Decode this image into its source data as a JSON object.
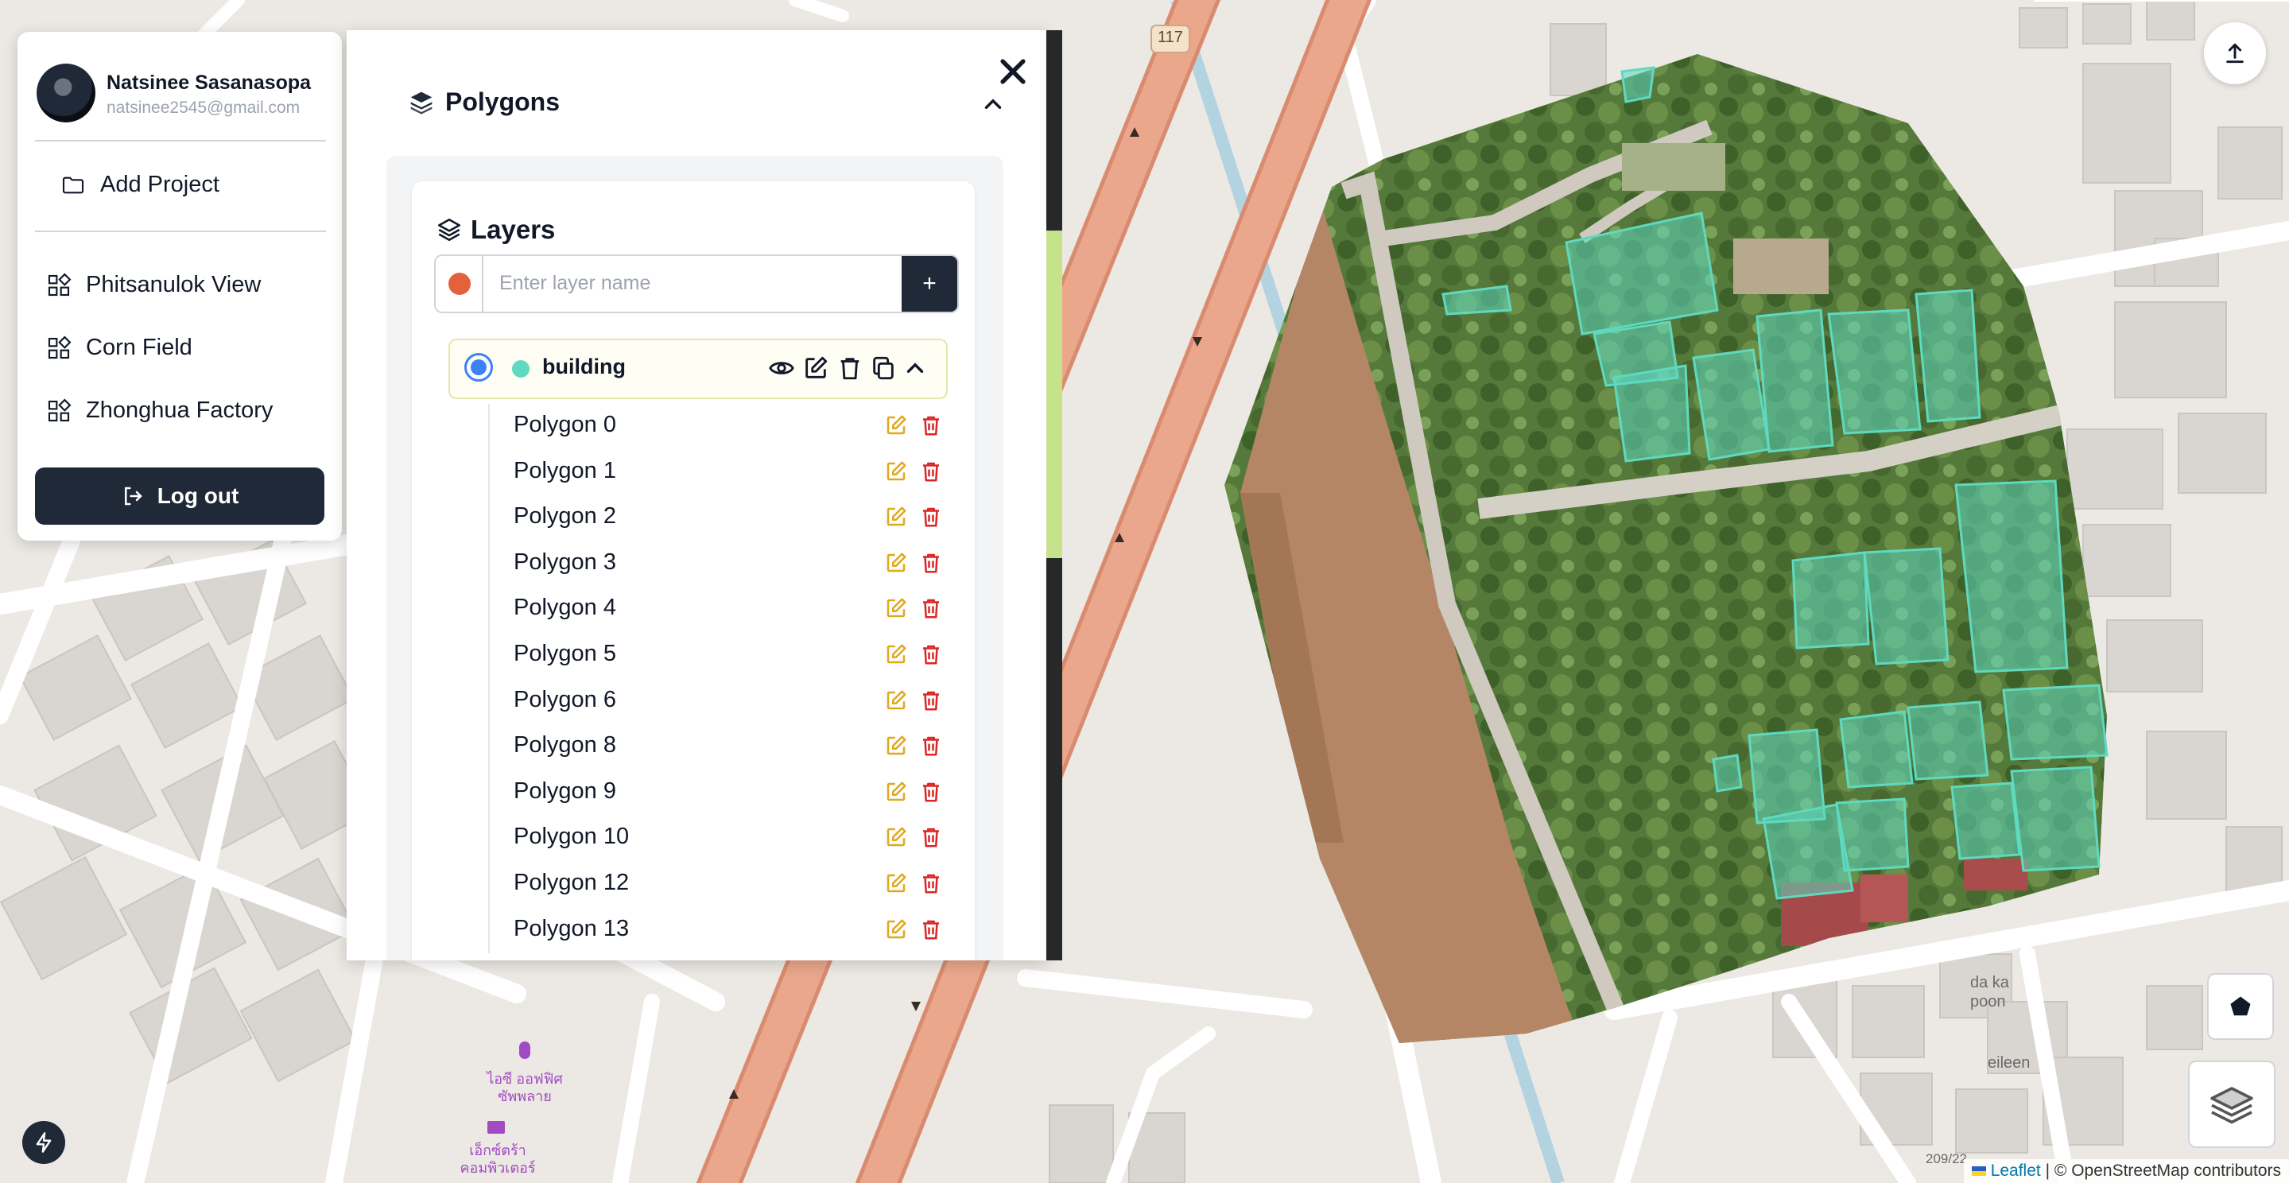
{
  "user": {
    "name": "Natsinee Sasanasopa",
    "email": "natsinee2545@gmail.com"
  },
  "menu": {
    "add_project": "Add Project",
    "projects": [
      "Phitsanulok View",
      "Corn Field",
      "Zhonghua Factory"
    ],
    "logout": "Log out"
  },
  "polygons_panel": {
    "title": "Polygons",
    "layers_title": "Layers",
    "input_placeholder": "Enter layer name",
    "add_button": "+",
    "new_layer_color": "#e4623b",
    "layer": {
      "name": "building",
      "color": "#5fd9bf",
      "selected": true
    },
    "polygons": [
      "Polygon 0",
      "Polygon 1",
      "Polygon 2",
      "Polygon 3",
      "Polygon 4",
      "Polygon 5",
      "Polygon 6",
      "Polygon 8",
      "Polygon 9",
      "Polygon 10",
      "Polygon 12",
      "Polygon 13"
    ]
  },
  "map": {
    "road_label": "117",
    "labels": [
      "da ka poon",
      "eileen",
      "209/22"
    ],
    "poi_1": "ไอซี ออฟฟิศ ซัพพลาย",
    "poi_2": "เอ็กซ์ตร้า คอมพิวเตอร์",
    "attribution_leaflet": "Leaflet",
    "attribution_rest": "| © OpenStreetMap contributors"
  },
  "colors": {
    "accent_dark": "#1f2937",
    "polygon_fill": "#5fd9bf",
    "edit_icon": "#e0a81d",
    "delete_icon": "#dc2626",
    "scroll_thumb": "#c6e38c"
  }
}
